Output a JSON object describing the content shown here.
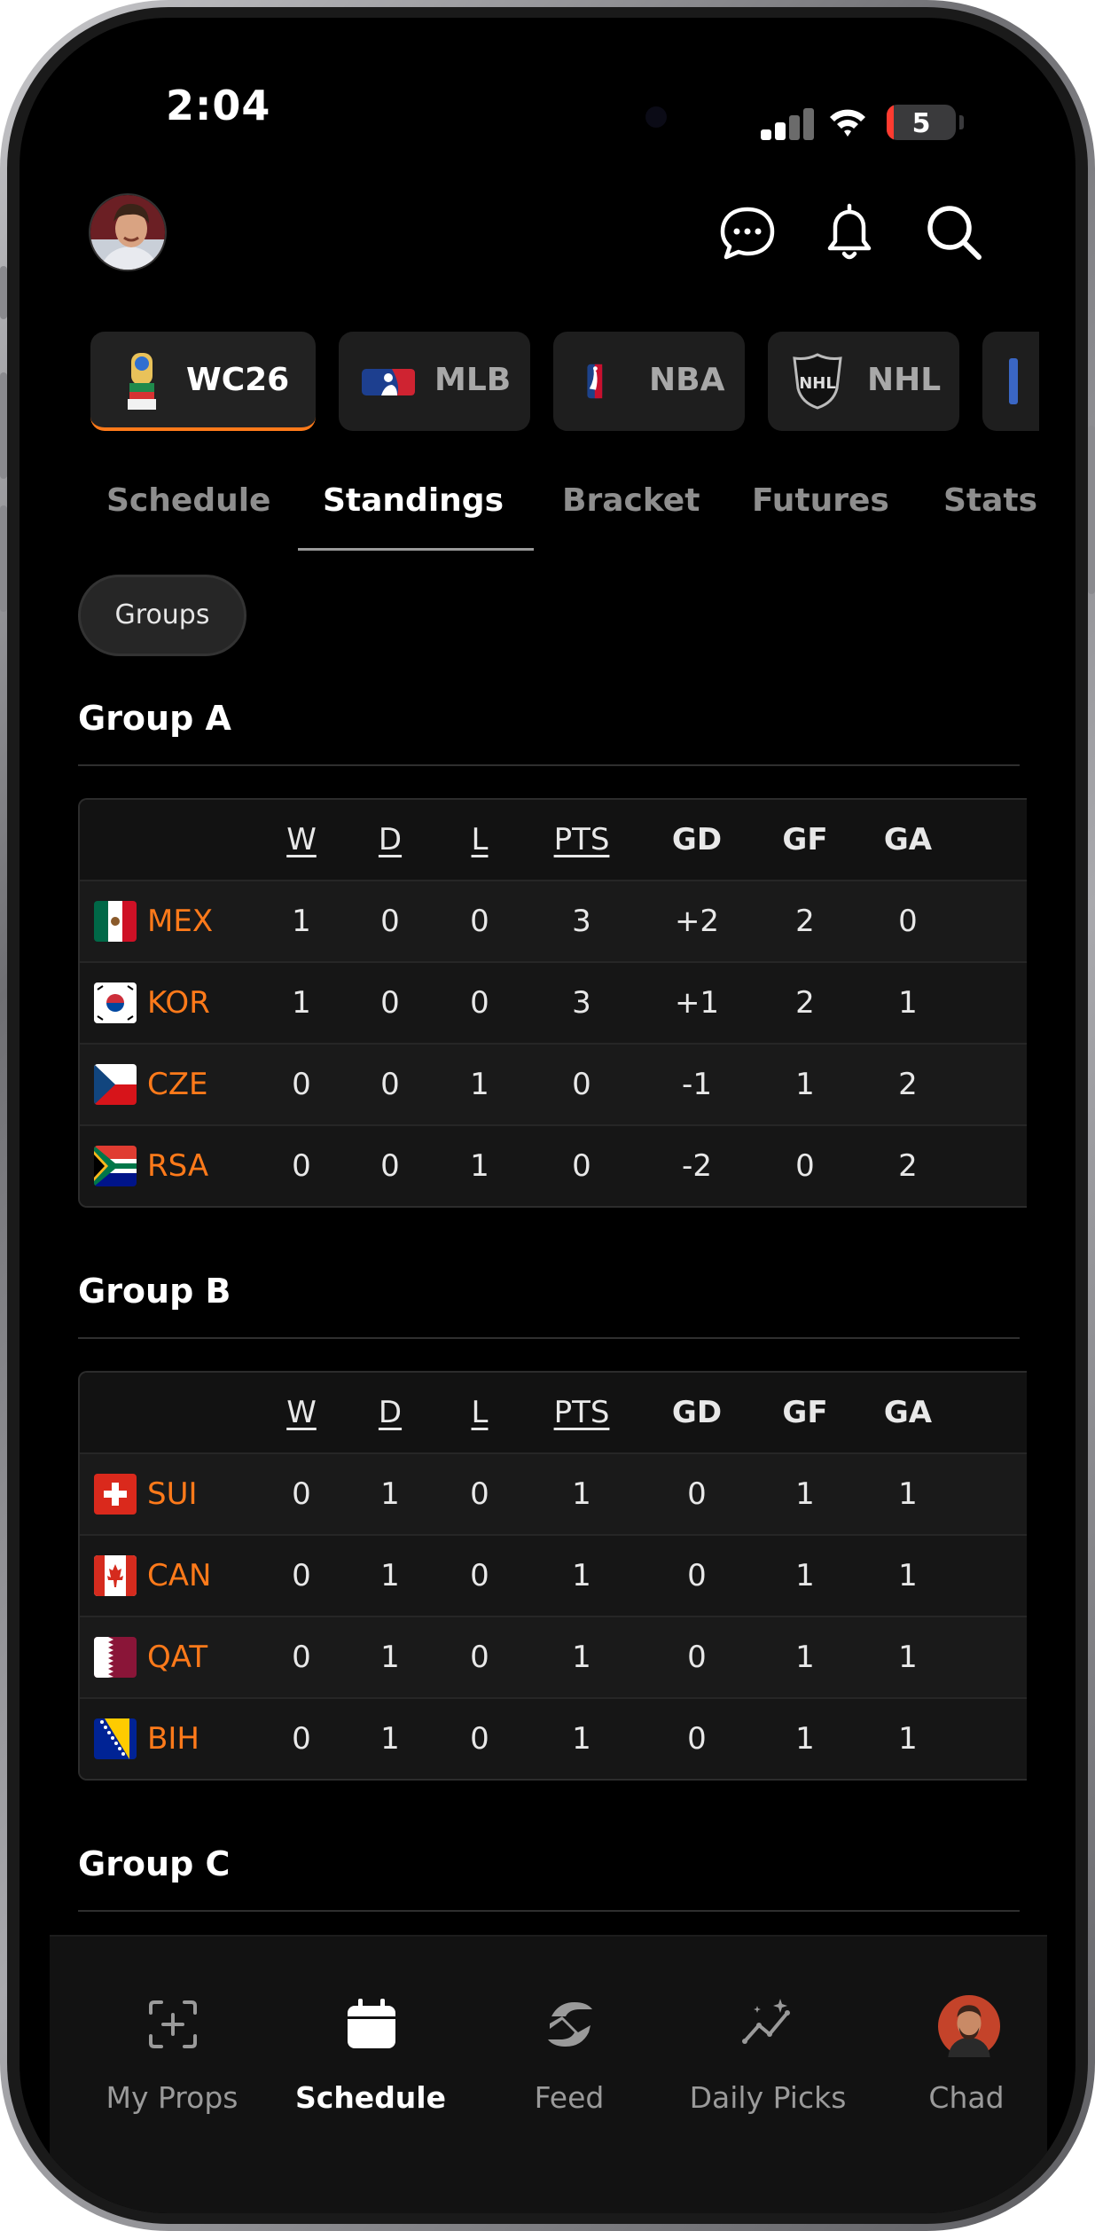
{
  "status_bar": {
    "time": "2:04",
    "battery_level": "5"
  },
  "leagues": [
    {
      "label": "WC26",
      "icon": "world-cup-trophy-icon",
      "active": true
    },
    {
      "label": "MLB",
      "icon": "mlb-logo-icon",
      "active": false
    },
    {
      "label": "NBA",
      "icon": "nba-logo-icon",
      "active": false
    },
    {
      "label": "NHL",
      "icon": "nhl-logo-icon",
      "active": false
    }
  ],
  "tabs": [
    {
      "label": "Schedule"
    },
    {
      "label": "Standings",
      "active": true
    },
    {
      "label": "Bracket"
    },
    {
      "label": "Futures"
    },
    {
      "label": "Stats"
    }
  ],
  "filter_chip": "Groups",
  "columns": [
    "W",
    "D",
    "L",
    "PTS",
    "GD",
    "GF",
    "GA"
  ],
  "groups": [
    {
      "title": "Group A",
      "rows": [
        {
          "team": "MEX",
          "w": "1",
          "d": "0",
          "l": "0",
          "pts": "3",
          "gd": "+2",
          "gf": "2",
          "ga": "0"
        },
        {
          "team": "KOR",
          "w": "1",
          "d": "0",
          "l": "0",
          "pts": "3",
          "gd": "+1",
          "gf": "2",
          "ga": "1"
        },
        {
          "team": "CZE",
          "w": "0",
          "d": "0",
          "l": "1",
          "pts": "0",
          "gd": "-1",
          "gf": "1",
          "ga": "2"
        },
        {
          "team": "RSA",
          "w": "0",
          "d": "0",
          "l": "1",
          "pts": "0",
          "gd": "-2",
          "gf": "0",
          "ga": "2"
        }
      ]
    },
    {
      "title": "Group B",
      "rows": [
        {
          "team": "SUI",
          "w": "0",
          "d": "1",
          "l": "0",
          "pts": "1",
          "gd": "0",
          "gf": "1",
          "ga": "1"
        },
        {
          "team": "CAN",
          "w": "0",
          "d": "1",
          "l": "0",
          "pts": "1",
          "gd": "0",
          "gf": "1",
          "ga": "1"
        },
        {
          "team": "QAT",
          "w": "0",
          "d": "1",
          "l": "0",
          "pts": "1",
          "gd": "0",
          "gf": "1",
          "ga": "1"
        },
        {
          "team": "BIH",
          "w": "0",
          "d": "1",
          "l": "0",
          "pts": "1",
          "gd": "0",
          "gf": "1",
          "ga": "1"
        }
      ]
    },
    {
      "title": "Group C"
    }
  ],
  "bottom_nav": [
    {
      "label": "My Props",
      "icon": "add-square-icon"
    },
    {
      "label": "Schedule",
      "icon": "calendar-icon",
      "active": true
    },
    {
      "label": "Feed",
      "icon": "feed-logo-icon"
    },
    {
      "label": "Daily Picks",
      "icon": "trend-sparkle-icon"
    },
    {
      "label": "Chad",
      "icon": "chad-avatar"
    }
  ],
  "colors": {
    "accent": "#ff7a1a",
    "background": "#000000",
    "surface": "#1a1a1a"
  }
}
